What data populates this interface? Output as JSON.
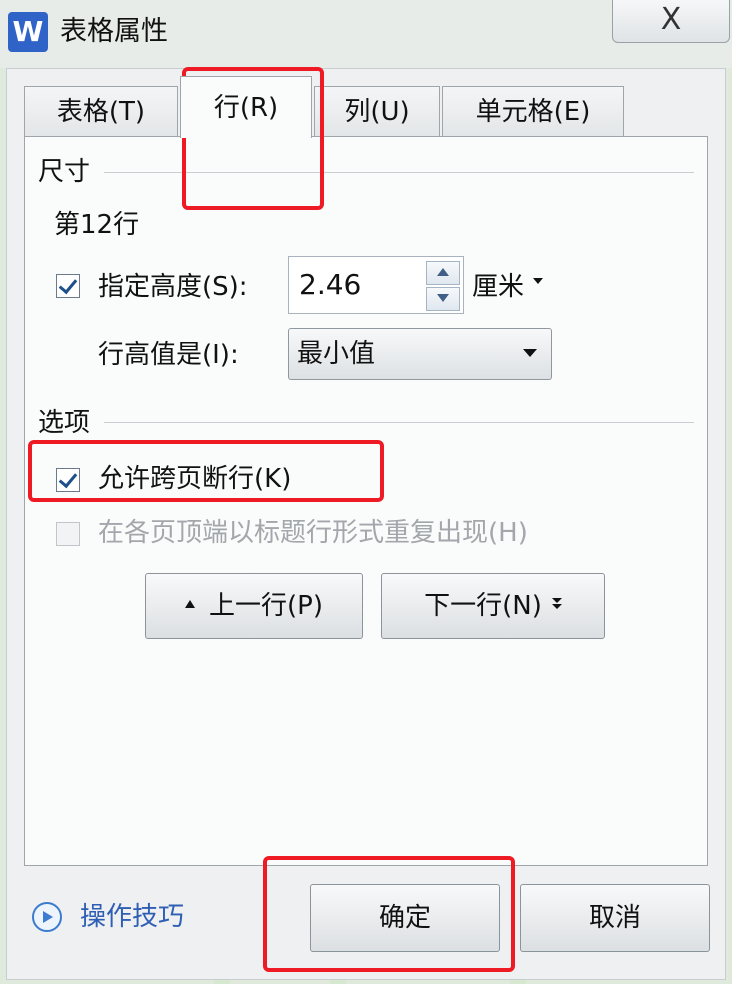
{
  "window": {
    "app_icon_letter": "W",
    "title": "表格属性",
    "close_symbol": "X"
  },
  "tabs": [
    {
      "label": "表格(T)"
    },
    {
      "label": "行(R)",
      "active": true
    },
    {
      "label": "列(U)"
    },
    {
      "label": "单元格(E)"
    }
  ],
  "size_section": {
    "heading": "尺寸",
    "row_label": "第12行",
    "specify_height_label": "指定高度(S):",
    "specify_height_checked": true,
    "height_value": "2.46",
    "height_unit": "厘米",
    "row_height_is_label": "行高值是(I):",
    "row_height_is_value": "最小值"
  },
  "options_section": {
    "heading": "选项",
    "allow_break_label": "允许跨页断行(K)",
    "allow_break_checked": true,
    "repeat_header_label": "在各页顶端以标题行形式重复出现(H)",
    "repeat_header_checked": false
  },
  "nav": {
    "prev_label": "上一行(P)",
    "next_label": "下一行(N)"
  },
  "footer": {
    "tips_label": "操作技巧",
    "ok_label": "确定",
    "cancel_label": "取消"
  },
  "colors": {
    "highlight": "#ee1b24",
    "accent": "#2f63c8"
  }
}
